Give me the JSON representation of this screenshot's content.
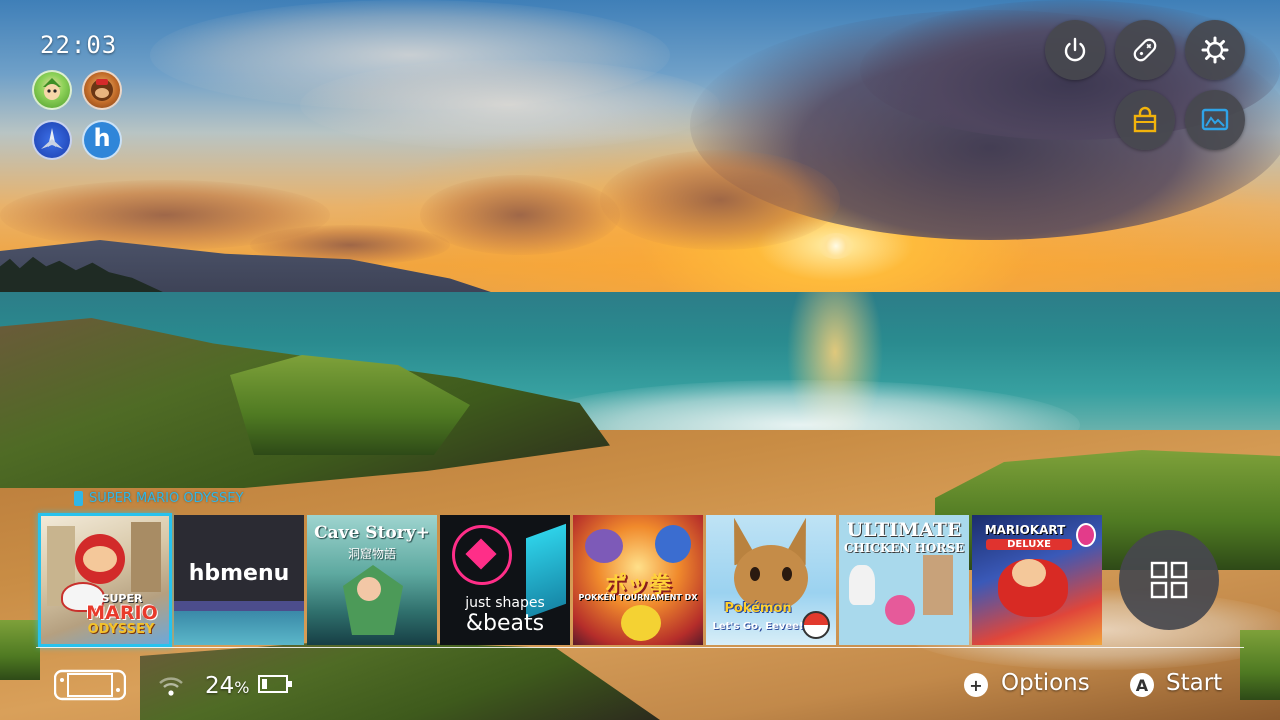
{
  "status": {
    "time": "22:03",
    "battery_percent": "24",
    "battery_unit": "%",
    "battery_level": 0.24
  },
  "users": [
    {
      "name": "user-1",
      "color": "#63b03a"
    },
    {
      "name": "user-2",
      "color": "#c8762a"
    },
    {
      "name": "user-3",
      "color": "#2a5bd1"
    },
    {
      "name": "user-4",
      "color": "#2f86d9"
    }
  ],
  "user_icon_letter": "h",
  "selected_game": {
    "title": "SUPER MARIO ODYSSEY"
  },
  "games": [
    {
      "id": "super-mario-odyssey",
      "line1": "SUPER",
      "line2": "MARIO",
      "line3": "ODYSSEY"
    },
    {
      "id": "hbmenu",
      "line1": "hbmenu"
    },
    {
      "id": "cave-story",
      "line1": "Cave Story+",
      "line2": "洞窟物語"
    },
    {
      "id": "just-shapes-beats",
      "line1": "just shapes",
      "line2": "&beats"
    },
    {
      "id": "pokken-tournament-dx",
      "line1": "ポッ拳",
      "line2": "POKKÉN TOURNAMENT DX"
    },
    {
      "id": "pokemon-lets-go-eevee",
      "line1": "Pokémon",
      "line2": "Let's Go, Eevee!"
    },
    {
      "id": "ultimate-chicken-horse",
      "line1": "ULTIMATE",
      "line2": "CHICKEN HORSE"
    },
    {
      "id": "mario-kart-8-deluxe",
      "line1": "MARIOKART",
      "line2": "DELUXE"
    }
  ],
  "hints": {
    "options_glyph": "+",
    "options_label": "Options",
    "start_glyph": "A",
    "start_label": "Start"
  },
  "colors": {
    "accent": "#27c2ee",
    "button_bg": "#46484e",
    "shop_icon": "#f2b30c",
    "album_icon": "#2fa3e7"
  }
}
